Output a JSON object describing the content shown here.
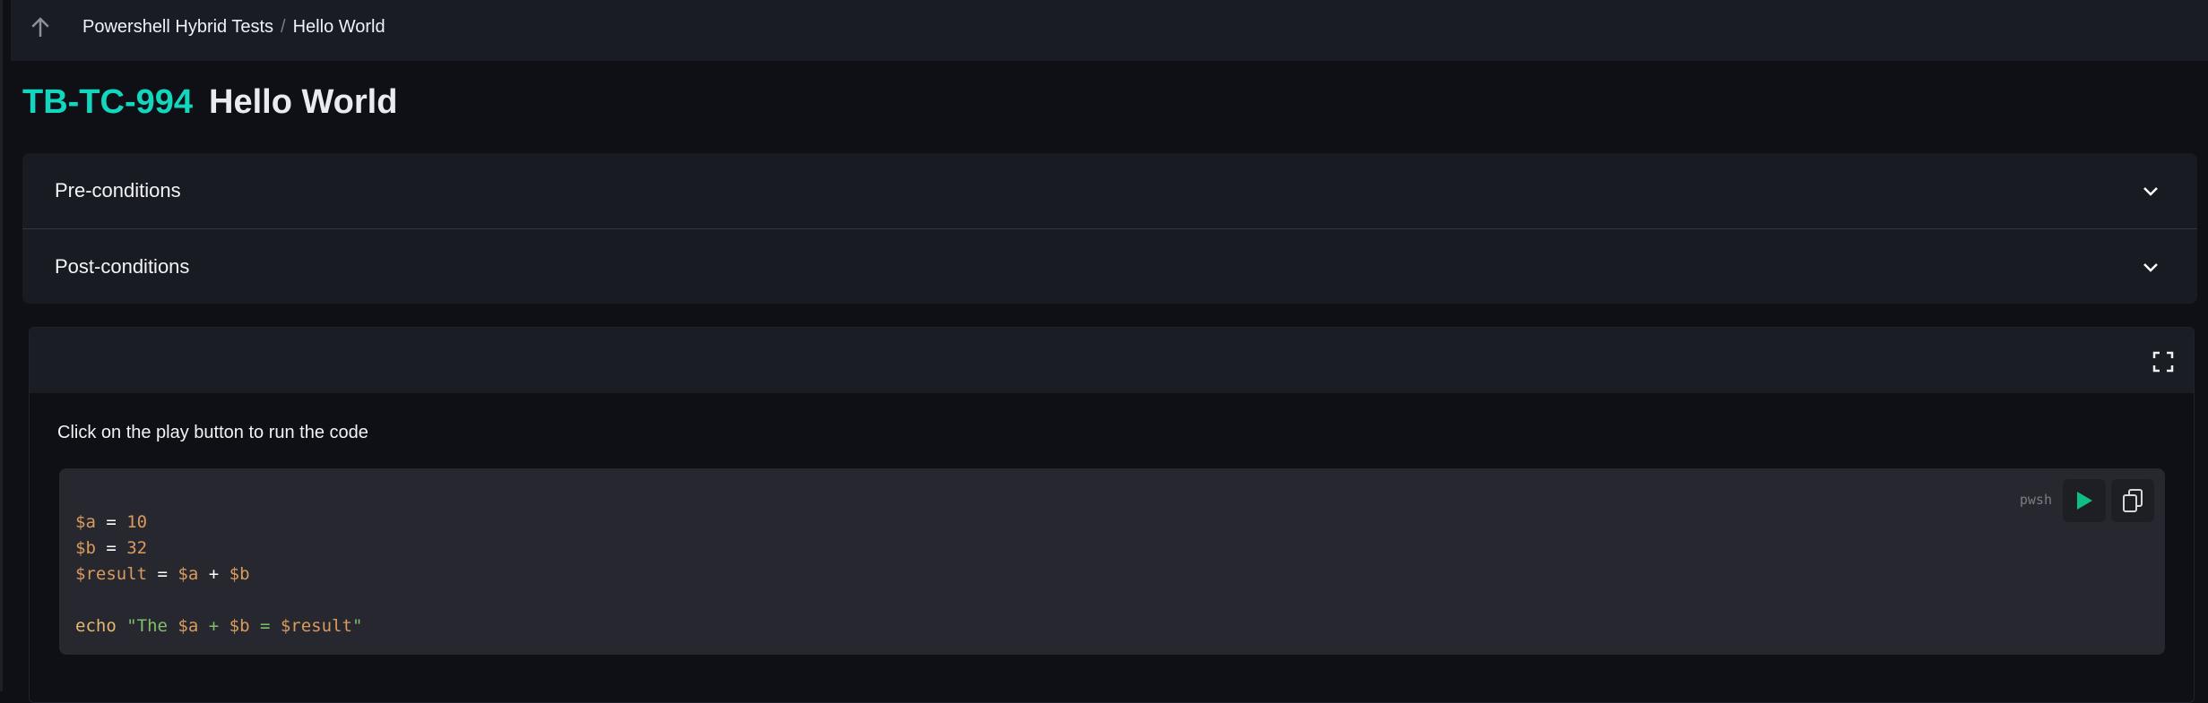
{
  "breadcrumb": {
    "parent": "Powershell Hybrid Tests",
    "separator": "/",
    "current": "Hello World"
  },
  "title": {
    "id": "TB-TC-994",
    "name": "Hello World"
  },
  "accordion": [
    {
      "label": "Pre-conditions"
    },
    {
      "label": "Post-conditions"
    }
  ],
  "panel": {
    "hint": "Click on the play button to run the code",
    "language": "pwsh",
    "code": {
      "l1": [
        "$a",
        " = ",
        "10"
      ],
      "l2": [
        "$b",
        " = ",
        "32"
      ],
      "l3": [
        "$result",
        " = ",
        "$a",
        " + ",
        "$b"
      ],
      "l5": [
        "echo",
        " ",
        "\"The ",
        "$a",
        " + ",
        "$b",
        " = ",
        "$result",
        "\""
      ]
    }
  },
  "colors": {
    "accent": "#12d6bd",
    "play": "#10bd82"
  },
  "icons": [
    "arrow-up-icon",
    "chevron-down-icon",
    "expand-icon",
    "play-icon",
    "copy-icon"
  ]
}
